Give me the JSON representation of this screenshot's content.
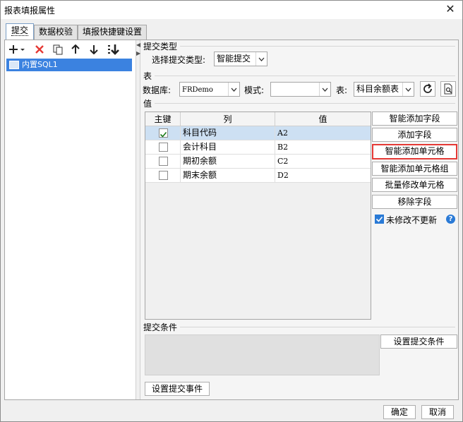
{
  "window": {
    "title": "报表填报属性"
  },
  "tabs": [
    {
      "label": "提交",
      "active": true
    },
    {
      "label": "数据校验",
      "active": false
    },
    {
      "label": "填报快捷键设置",
      "active": false
    }
  ],
  "tree": {
    "items": [
      {
        "label": "内置SQL1",
        "selected": true
      }
    ]
  },
  "submit_type": {
    "section": "提交类型",
    "label": "选择提交类型:",
    "value": "智能提交"
  },
  "table_section": {
    "section": "表",
    "db_label": "数据库:",
    "db_value": "FRDemo",
    "mode_label": "模式:",
    "mode_value": "",
    "table_label": "表:",
    "table_value": "科目余额表"
  },
  "values": {
    "section": "值",
    "columns": [
      "主键",
      "列",
      "值"
    ],
    "rows": [
      {
        "key": true,
        "column": "科目代码",
        "value": "A2",
        "selected": true
      },
      {
        "key": false,
        "column": "会计科目",
        "value": "B2",
        "selected": false
      },
      {
        "key": false,
        "column": "期初余额",
        "value": "C2",
        "selected": false
      },
      {
        "key": false,
        "column": "期末余额",
        "value": "D2",
        "selected": false
      }
    ]
  },
  "side_buttons": {
    "smart_add_field": "智能添加字段",
    "add_field": "添加字段",
    "smart_add_cell": "智能添加单元格",
    "smart_add_cell_group": "智能添加单元格组",
    "batch_modify_cell": "批量修改单元格",
    "remove_field": "移除字段"
  },
  "no_update_unmodified": {
    "label": "未修改不更新",
    "checked": true
  },
  "condition": {
    "section": "提交条件",
    "button": "设置提交条件"
  },
  "event_button": "设置提交事件",
  "footer": {
    "ok": "确定",
    "cancel": "取消"
  },
  "colors": {
    "selection": "#3b82e0",
    "row_selected": "#cde0f3",
    "focus_border": "#e53935",
    "accent": "#2a7ad6"
  }
}
